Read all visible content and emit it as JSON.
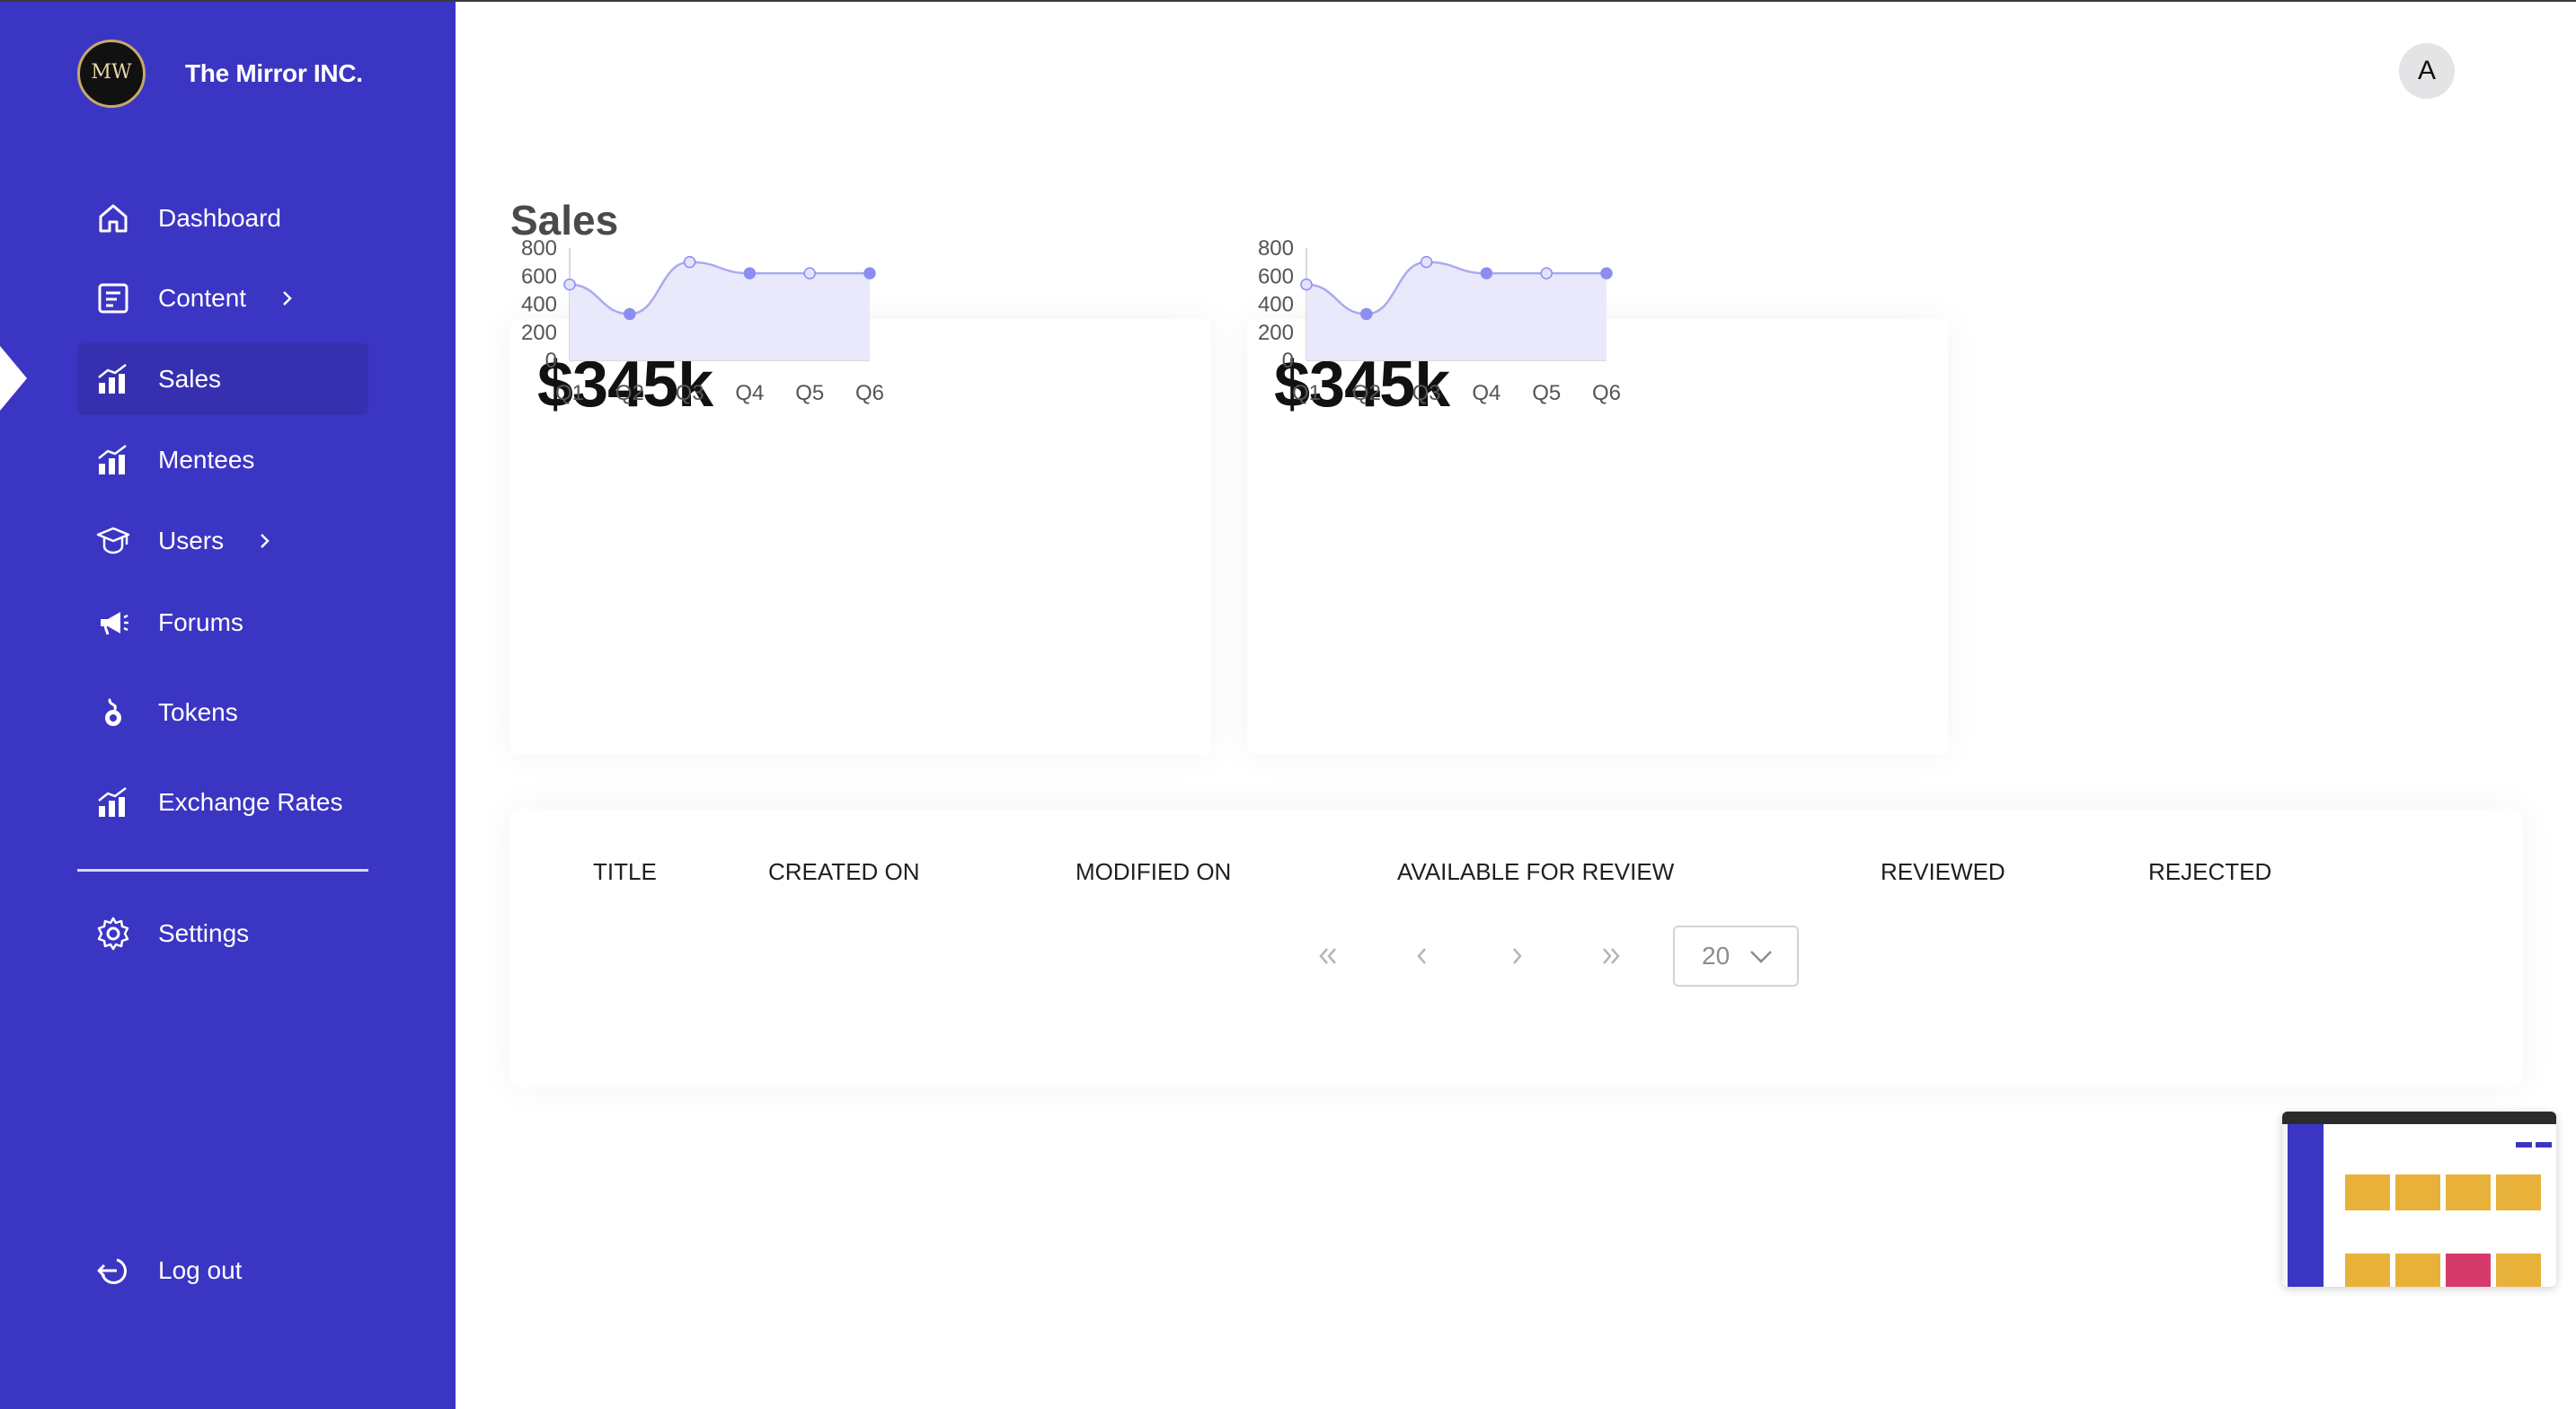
{
  "brand": {
    "name": "The Mirror INC.",
    "logo_text": "MW"
  },
  "sidebar": {
    "items": [
      {
        "label": "Dashboard",
        "icon": "home-icon"
      },
      {
        "label": "Content",
        "icon": "document-icon",
        "has_submenu": true
      },
      {
        "label": "Sales",
        "icon": "bar-chart-icon",
        "active": true
      },
      {
        "label": "Mentees",
        "icon": "bar-chart-icon"
      },
      {
        "label": "Users",
        "icon": "graduation-cap-icon",
        "has_submenu": true
      },
      {
        "label": "Forums",
        "icon": "megaphone-icon"
      },
      {
        "label": "Tokens",
        "icon": "coin-hand-icon"
      },
      {
        "label": "Exchange Rates",
        "icon": "bar-chart-icon"
      }
    ],
    "settings": {
      "label": "Settings",
      "icon": "gear-icon"
    },
    "logout": {
      "label": "Log out",
      "icon": "logout-icon"
    }
  },
  "header": {
    "avatar_initial": "A"
  },
  "page": {
    "title": "Sales"
  },
  "cards": [
    {
      "value": "$345k"
    },
    {
      "value": "$345k"
    }
  ],
  "chart_data": [
    {
      "type": "area",
      "title": "",
      "categories": [
        "Q1",
        "Q2",
        "Q3",
        "Q4",
        "Q5",
        "Q6"
      ],
      "values": [
        540,
        330,
        700,
        620,
        620,
        620
      ],
      "ylim": [
        0,
        800
      ],
      "yticks": [
        0,
        200,
        400,
        600,
        800
      ],
      "fill_color": "#e9e9fb",
      "line_color": "#a9aaf0",
      "point_color": "#8b8ef0"
    },
    {
      "type": "area",
      "title": "",
      "categories": [
        "Q1",
        "Q2",
        "Q3",
        "Q4",
        "Q5",
        "Q6"
      ],
      "values": [
        540,
        330,
        700,
        620,
        620,
        620
      ],
      "ylim": [
        0,
        800
      ],
      "yticks": [
        0,
        200,
        400,
        600,
        800
      ],
      "fill_color": "#e9e9fb",
      "line_color": "#a9aaf0",
      "point_color": "#8b8ef0"
    }
  ],
  "table": {
    "columns": [
      "TITLE",
      "CREATED ON",
      "MODIFIED ON",
      "AVAILABLE FOR REVIEW",
      "REVIEWED",
      "REJECTED"
    ],
    "rows": []
  },
  "pagination": {
    "page_size": "20"
  }
}
